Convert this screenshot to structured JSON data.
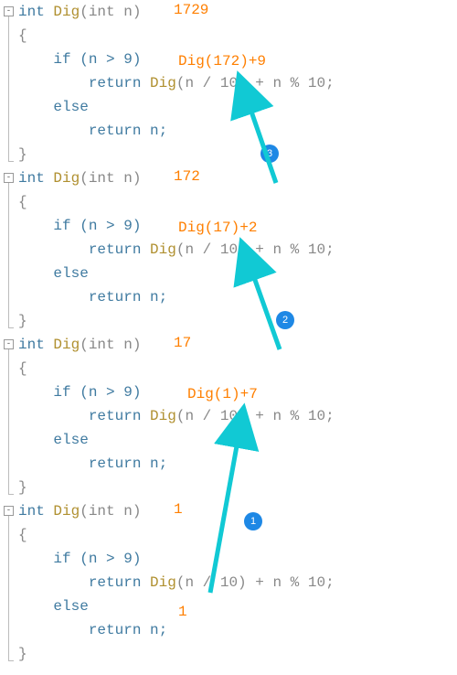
{
  "blocks": [
    {
      "header_n": "1729",
      "anno_call": "Dig(172)+9",
      "lines": {
        "sig_pre": "int ",
        "sig_fn": "Dig",
        "sig_post": "(int n)",
        "brace_o": "{",
        "if": "    if (n > 9)",
        "ret1a": "        return ",
        "ret1b": "Dig",
        "ret1c": "(n / 10) + n % 10;",
        "else": "    else",
        "ret2": "        return n;",
        "brace_c": "}"
      }
    },
    {
      "header_n": "172",
      "anno_call": "Dig(17)+2",
      "lines": {
        "sig_pre": "int ",
        "sig_fn": "Dig",
        "sig_post": "(int n)",
        "brace_o": "{",
        "if": "    if (n > 9)",
        "ret1a": "        return ",
        "ret1b": "Dig",
        "ret1c": "(n / 10) + n % 10;",
        "else": "    else",
        "ret2": "        return n;",
        "brace_c": "}"
      }
    },
    {
      "header_n": "17",
      "anno_call": "Dig(1)+7",
      "lines": {
        "sig_pre": "int ",
        "sig_fn": "Dig",
        "sig_post": "(int n)",
        "brace_o": "{",
        "if": "    if (n > 9)",
        "ret1a": "        return ",
        "ret1b": "Dig",
        "ret1c": "(n / 10) + n % 10;",
        "else": "    else",
        "ret2": "        return n;",
        "brace_c": "}"
      }
    },
    {
      "header_n": "1",
      "anno_call": "",
      "base_value": "1",
      "lines": {
        "sig_pre": "int ",
        "sig_fn": "Dig",
        "sig_post": "(int n)",
        "brace_o": "{",
        "if": "    if (n > 9)",
        "ret1a": "        return ",
        "ret1b": "Dig",
        "ret1c": "(n / 10) + n % 10;",
        "else": "    else",
        "ret2": "        return n;",
        "brace_c": "}"
      }
    }
  ],
  "badges": {
    "b1": "1",
    "b2": "2",
    "b3": "3"
  }
}
